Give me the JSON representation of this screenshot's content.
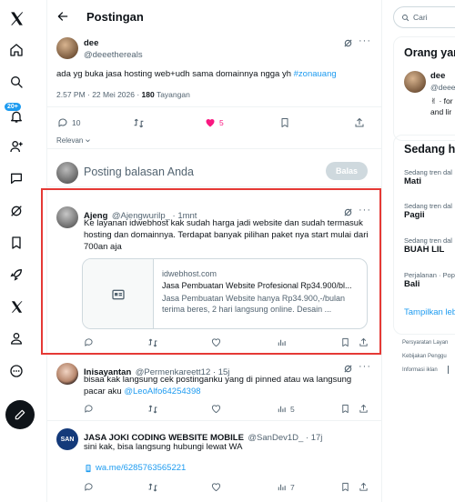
{
  "colors": {
    "accent": "#1d9bf0",
    "like": "#f91880",
    "highlight": "#e0245e",
    "text": "#0f1419",
    "muted": "#536471",
    "border": "#eff3f4"
  },
  "sidebar": {
    "badge": "20+",
    "icons": [
      "x-logo-icon",
      "home-icon",
      "search-icon",
      "notifications-icon",
      "follow-icon",
      "messages-icon",
      "grok-icon",
      "bookmarks-icon",
      "rocket-icon",
      "premium-x-icon",
      "profile-icon",
      "more-icon",
      "compose-icon"
    ]
  },
  "header": {
    "title": "Postingan"
  },
  "post": {
    "name": "dee",
    "handle": "@deeethereals",
    "text": "ada yg buka jasa hosting web+udh sama domainnya ngga yh ",
    "hashtag": "#zonauang",
    "time": "2.57 PM · 22 Mei 2026 · ",
    "views": "180",
    "views_label": " Tayangan",
    "replies": "10",
    "likes": "5"
  },
  "relevan": "Relevan",
  "reply_box": {
    "placeholder": "Posting balasan Anda",
    "button": "Balas"
  },
  "replies": [
    {
      "name": "Ajeng",
      "handle": "@Ajengwurilp_ · 1mnt",
      "text": "Ke layanan idwebhost kak sudah harga jadi website dan sudah termasuk hosting dan domainnya. Terdapat banyak pilihan paket nya start mulai dari 700an aja",
      "card": {
        "domain": "idwebhost.com",
        "title": "Jasa Pembuatan Website Profesional Rp34.900/bl...",
        "desc": "Jasa Pembuatan Website hanya Rp34.900,-/bulan terima beres, 2 hari langsung online. Desain ..."
      }
    },
    {
      "name": "Inisayantan",
      "handle": "@Permenkareett12 · 15j",
      "text": "bisaa kak langsung cek postinganku yang di pinned atau wa langsung pacar aku ",
      "mention": "@LeoAlfo64254398",
      "views": "5"
    },
    {
      "name": "JASA JOKI CODING WEBSITE MOBILE",
      "handle": "@SanDev1D_ · 17j",
      "avatar_text": "SAN",
      "text": "sini kak, bisa langsung hubungi lewat WA",
      "link": "wa.me/6285763565221",
      "views": "7"
    }
  ],
  "right": {
    "search_placeholder": "Cari",
    "who_title": "Orang yan",
    "who_name": "dee",
    "who_handle": "@deee",
    "who_bio1": "✌︎ · for l",
    "who_bio2": "and lir",
    "trends_title": "Sedang h",
    "trends": [
      {
        "cat": "Sedang tren dal",
        "name": "Mati"
      },
      {
        "cat": "Sedang tren dal",
        "name": "Pagii"
      },
      {
        "cat": "Sedang tren dal",
        "name": "BUAH LIL"
      },
      {
        "cat": "Perjalanan · Pop",
        "name": "Bali"
      }
    ],
    "show_more": "Tampilkan leb",
    "footer1": "Persyaratan Layan",
    "footer2": "Kebijakan Penggu",
    "footer3": "Informasi iklan"
  }
}
